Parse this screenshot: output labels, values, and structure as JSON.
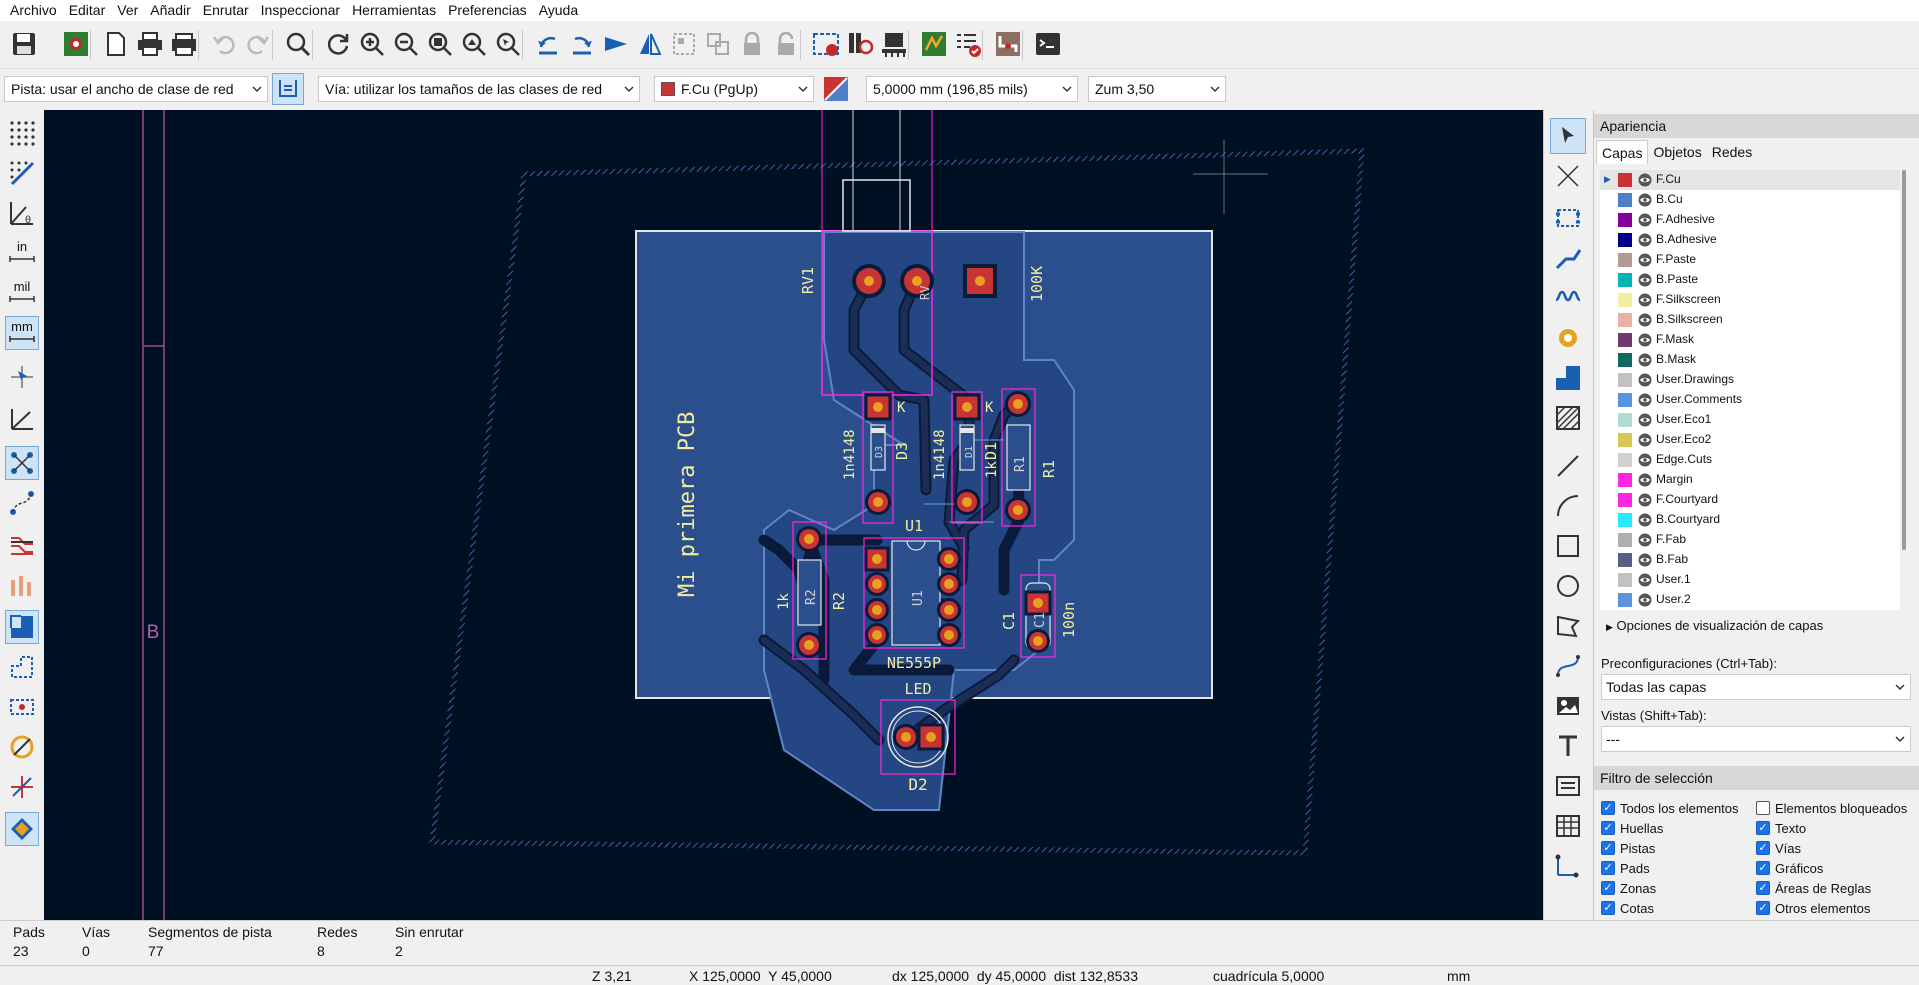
{
  "menu": [
    "Archivo",
    "Editar",
    "Ver",
    "Añadir",
    "Enrutar",
    "Inspeccionar",
    "Herramientas",
    "Preferencias",
    "Ayuda"
  ],
  "toolbar2": {
    "track_width": "Pista: usar el ancho de clase de red",
    "via_size": "Vía: utilizar los tamaños de las clases de red",
    "layer": "F.Cu (PgUp)",
    "layer_color": "#c83434",
    "grid": "5,0000 mm (196,85 mils)",
    "zoom": "Zum 3,50"
  },
  "left_toolbar": {
    "in_label": "in",
    "mil_label": "mil",
    "mm_label": "mm"
  },
  "board": {
    "title_text": "Mi primera PCB",
    "rail_label": "B",
    "refs": {
      "rv1": "RV1",
      "rv1_val": "100K",
      "rv1_pad": "RV",
      "d3": "D3",
      "d3_val": "1n4148",
      "d3_in": "D3",
      "d3_k": "K",
      "d1": "D1",
      "d1_val": "1n4148",
      "d1_in": "D1",
      "d1_k": "K",
      "r1": "R1",
      "r1_val": "1k",
      "r1_in": "R1",
      "u1": "U1",
      "u1_in": "U1",
      "u1_val": "NE555P",
      "r2": "R2",
      "r2_val": "1k",
      "r2_in": "R2",
      "c1": "C1",
      "c1_val": "100n",
      "c1_in": "C1",
      "led": "LED",
      "d2": "D2"
    }
  },
  "appearance": {
    "title": "Apariencia",
    "tabs": [
      "Capas",
      "Objetos",
      "Redes"
    ],
    "layers": [
      {
        "name": "F.Cu",
        "color": "#c83434"
      },
      {
        "name": "B.Cu",
        "color": "#4d7fc4"
      },
      {
        "name": "F.Adhesive",
        "color": "#84009c"
      },
      {
        "name": "B.Adhesive",
        "color": "#00008c"
      },
      {
        "name": "F.Paste",
        "color": "#b49a96"
      },
      {
        "name": "B.Paste",
        "color": "#00b4b4"
      },
      {
        "name": "F.Silkscreen",
        "color": "#f2eda1"
      },
      {
        "name": "B.Silkscreen",
        "color": "#e8b2a7"
      },
      {
        "name": "F.Mask",
        "color": "#6e3a6e"
      },
      {
        "name": "B.Mask",
        "color": "#0e6a5e"
      },
      {
        "name": "User.Drawings",
        "color": "#c2c2c2"
      },
      {
        "name": "User.Comments",
        "color": "#5994dc"
      },
      {
        "name": "User.Eco1",
        "color": "#b4dbd2"
      },
      {
        "name": "User.Eco2",
        "color": "#d8c852"
      },
      {
        "name": "Edge.Cuts",
        "color": "#d0d2cd"
      },
      {
        "name": "Margin",
        "color": "#ff26e2"
      },
      {
        "name": "F.Courtyard",
        "color": "#ff26e2"
      },
      {
        "name": "B.Courtyard",
        "color": "#26e9ff"
      },
      {
        "name": "F.Fab",
        "color": "#afafaf"
      },
      {
        "name": "B.Fab",
        "color": "#585d84"
      },
      {
        "name": "User.1",
        "color": "#c2c2c2"
      },
      {
        "name": "User.2",
        "color": "#5994dc"
      }
    ],
    "layer_options": "Opciones de visualización de capas",
    "presets_label": "Preconfiguraciones (Ctrl+Tab):",
    "presets_value": "Todas las capas",
    "views_label": "Vistas (Shift+Tab):",
    "views_value": "---"
  },
  "selection_filter": {
    "title": "Filtro de selección",
    "items": [
      {
        "label": "Todos los elementos",
        "checked": true
      },
      {
        "label": "Elementos bloqueados",
        "checked": false
      },
      {
        "label": "Huellas",
        "checked": true
      },
      {
        "label": "Texto",
        "checked": true
      },
      {
        "label": "Pistas",
        "checked": true
      },
      {
        "label": "Vías",
        "checked": true
      },
      {
        "label": "Pads",
        "checked": true
      },
      {
        "label": "Gráficos",
        "checked": true
      },
      {
        "label": "Zonas",
        "checked": true
      },
      {
        "label": "Áreas de Reglas",
        "checked": true
      },
      {
        "label": "Cotas",
        "checked": true
      },
      {
        "label": "Otros elementos",
        "checked": true
      }
    ]
  },
  "status": {
    "pads_label": "Pads",
    "pads": "23",
    "vias_label": "Vías",
    "vias": "0",
    "segments_label": "Segmentos de pista",
    "segments": "77",
    "nets_label": "Redes",
    "nets": "8",
    "unrouted_label": "Sin enrutar",
    "unrouted": "2"
  },
  "bottom": {
    "zoom": "Z 3,21",
    "xy": "X 125,0000  Y 45,0000",
    "dxy": "dx 125,0000  dy 45,0000  dist 132,8533",
    "grid": "cuadrícula 5,0000",
    "units": "mm"
  }
}
